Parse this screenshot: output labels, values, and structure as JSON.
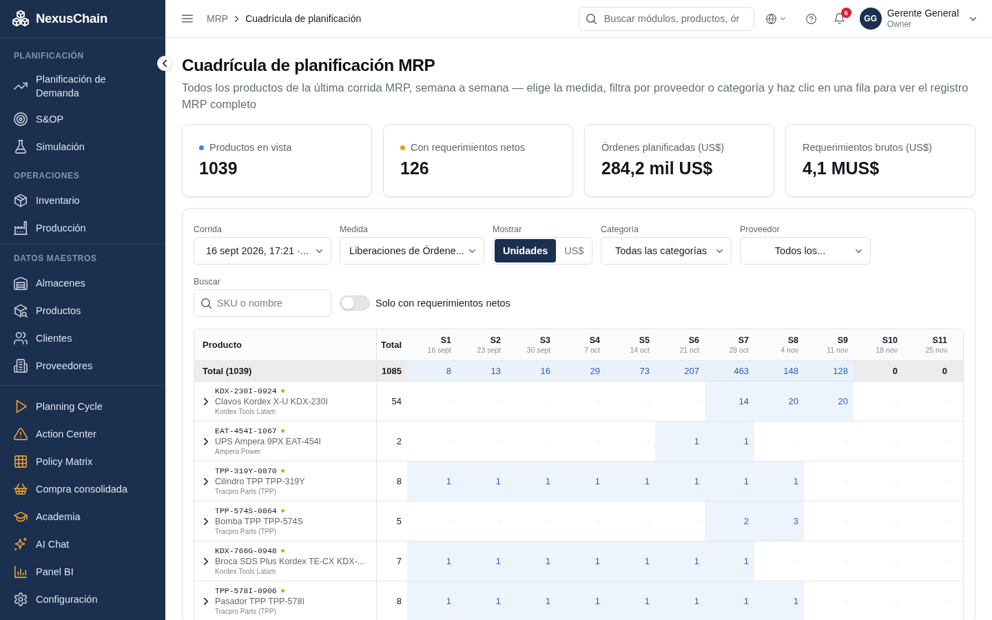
{
  "sidebar": {
    "brand": "NexusChain",
    "sections": [
      {
        "title": "PLANIFICACIÓN",
        "items": [
          {
            "label": "Planificación de Demanda",
            "selected": false
          },
          {
            "label": "S&OP",
            "selected": false
          },
          {
            "label": "Simulación",
            "selected": false
          }
        ]
      },
      {
        "title": "OPERACIONES",
        "items": [
          {
            "label": "Inventario",
            "selected": false
          },
          {
            "label": "Producción",
            "selected": false
          }
        ]
      },
      {
        "title": "DATOS MAESTROS",
        "items": [
          {
            "label": "Almacenes",
            "selected": false
          },
          {
            "label": "Productos",
            "selected": false
          },
          {
            "label": "Clientes",
            "selected": false
          },
          {
            "label": "Proveedores",
            "selected": false
          }
        ]
      },
      {
        "items": [
          {
            "label": "Planning Cycle",
            "selected": false,
            "color": "#e8a23b"
          },
          {
            "label": "Action Center",
            "selected": false,
            "color": "#e8a23b"
          },
          {
            "label": "Policy Matrix",
            "selected": false,
            "color": "#e8a23b"
          },
          {
            "label": "Compra consolidada",
            "selected": false,
            "color": "#e8a23b"
          },
          {
            "label": "Academia",
            "selected": false,
            "color": "#e8a23b"
          },
          {
            "label": "AI Chat",
            "selected": false,
            "color": "#e8a23b"
          },
          {
            "label": "Panel BI",
            "selected": false,
            "color": "#e8a23b"
          },
          {
            "label": "Configuración",
            "selected": false,
            "color": "#c3cddb"
          }
        ]
      }
    ]
  },
  "topbar": {
    "breadcrumb": [
      "MRP",
      "Cuadrícula de planificación"
    ],
    "search": {
      "placeholder": "Buscar módulos, productos, ór"
    },
    "notifications": "5",
    "user": {
      "initials": "GG",
      "name": "Gerente General",
      "role": "Owner"
    }
  },
  "page": {
    "title": "Cuadrícula de planificación MRP",
    "description": "Todos los productos de la última corrida MRP, semana a semana — elige la medida, filtra por proveedor o categoría y haz clic en una fila para ver el registro MRP completo"
  },
  "kpis": [
    {
      "label": "Productos en vista",
      "value": "1039",
      "color": "#3b82f6"
    },
    {
      "label": "Con requerimientos netos",
      "value": "126",
      "color": "#f59e0b"
    },
    {
      "label": "Órdenes planificadas (US$)",
      "value": "284,2 mil US$"
    },
    {
      "label": "Requerimientos brutos (US$)",
      "value": "4,1 MUS$"
    }
  ],
  "filters": [
    {
      "kind": "select",
      "label": "Corrida",
      "value": "16 sept 2026, 17:21 ·..."
    },
    {
      "kind": "select",
      "label": "Medida",
      "value": "Liberaciones de Órdene..."
    },
    {
      "kind": "segmented",
      "label": "Mostrar",
      "options": [
        {
          "label": "Unidades",
          "selected": true
        },
        {
          "label": "US$",
          "selected": false
        }
      ]
    },
    {
      "kind": "select",
      "label": "Categoría",
      "value": "Todas las categorías"
    },
    {
      "kind": "select",
      "label": "Proveedor",
      "value": "Todos los..."
    }
  ],
  "search": {
    "label": "Buscar",
    "placeholder": "SKU o nombre"
  },
  "net_only": {
    "label": "Solo con requerimientos netos",
    "on": false
  },
  "table": {
    "columns": [
      "Producto",
      "Total"
    ],
    "weeks": [
      {
        "label": "S1",
        "date": "16 sept"
      },
      {
        "label": "S2",
        "date": "23 sept"
      },
      {
        "label": "S3",
        "date": "30 sept"
      },
      {
        "label": "S4",
        "date": "7 oct"
      },
      {
        "label": "S5",
        "date": "14 oct"
      },
      {
        "label": "S6",
        "date": "21 oct"
      },
      {
        "label": "S7",
        "date": "28 oct"
      },
      {
        "label": "S8",
        "date": "4 nov"
      },
      {
        "label": "S9",
        "date": "11 nov"
      },
      {
        "label": "S10",
        "date": "18 nov"
      },
      {
        "label": "S11",
        "date": "25 nov"
      }
    ],
    "total_row": {
      "label": "Total (1039)",
      "total": "1085",
      "cells": [
        {
          "value": "8",
          "highlighted": true
        },
        {
          "value": "13",
          "highlighted": true
        },
        {
          "value": "16",
          "highlighted": true
        },
        {
          "value": "29",
          "highlighted": true
        },
        {
          "value": "73",
          "highlighted": true
        },
        {
          "value": "207",
          "highlighted": true
        },
        {
          "value": "463",
          "highlighted": true
        },
        {
          "value": "148",
          "highlighted": true
        },
        {
          "value": "128",
          "highlighted": true
        },
        {
          "value": "0",
          "highlighted": false
        },
        {
          "value": "0",
          "highlighted": false
        }
      ]
    },
    "rows": [
      {
        "sku": "KDX-230I-0924",
        "color": "#f59e0b",
        "name": "Clavos Kordex X-U KDX-230I",
        "supplier": "Kordex Tools Latam",
        "expanded": false,
        "total": "54",
        "cells": [
          {
            "value": "·",
            "highlighted": false
          },
          {
            "value": "·",
            "highlighted": false
          },
          {
            "value": "·",
            "highlighted": false
          },
          {
            "value": "·",
            "highlighted": false
          },
          {
            "value": "·",
            "highlighted": false
          },
          {
            "value": "·",
            "highlighted": false
          },
          {
            "value": "14",
            "highlighted": true
          },
          {
            "value": "20",
            "highlighted": true
          },
          {
            "value": "20",
            "highlighted": true
          },
          {
            "value": "·",
            "highlighted": false
          },
          {
            "value": "·",
            "highlighted": false
          }
        ]
      },
      {
        "sku": "EAT-454I-1067",
        "color": "#f59e0b",
        "name": "UPS Ampera 9PX EAT-454I",
        "supplier": "Ampera Power",
        "expanded": false,
        "total": "2",
        "cells": [
          {
            "value": "·",
            "highlighted": false
          },
          {
            "value": "·",
            "highlighted": false
          },
          {
            "value": "·",
            "highlighted": false
          },
          {
            "value": "·",
            "highlighted": false
          },
          {
            "value": "·",
            "highlighted": false
          },
          {
            "value": "1",
            "highlighted": true
          },
          {
            "value": "1",
            "highlighted": true
          },
          {
            "value": "·",
            "highlighted": false
          },
          {
            "value": "·",
            "highlighted": false
          },
          {
            "value": "·",
            "highlighted": false
          },
          {
            "value": "·",
            "highlighted": false
          }
        ]
      },
      {
        "sku": "TPP-319Y-0870",
        "color": "#f59e0b",
        "name": "Cilindro TPP TPP-319Y",
        "supplier": "Tracpro Parts (TPP)",
        "expanded": false,
        "total": "8",
        "cells": [
          {
            "value": "1",
            "highlighted": true
          },
          {
            "value": "1",
            "highlighted": true
          },
          {
            "value": "1",
            "highlighted": true
          },
          {
            "value": "1",
            "highlighted": true
          },
          {
            "value": "1",
            "highlighted": true
          },
          {
            "value": "1",
            "highlighted": true
          },
          {
            "value": "1",
            "highlighted": true
          },
          {
            "value": "1",
            "highlighted": true
          },
          {
            "value": "·",
            "highlighted": false
          },
          {
            "value": "·",
            "highlighted": false
          },
          {
            "value": "·",
            "highlighted": false
          }
        ]
      },
      {
        "sku": "TPP-574S-0864",
        "color": "#f59e0b",
        "name": "Bomba TPP TPP-574S",
        "supplier": "Tracpro Parts (TPP)",
        "expanded": false,
        "total": "5",
        "cells": [
          {
            "value": "·",
            "highlighted": false
          },
          {
            "value": "·",
            "highlighted": false
          },
          {
            "value": "·",
            "highlighted": false
          },
          {
            "value": "·",
            "highlighted": false
          },
          {
            "value": "·",
            "highlighted": false
          },
          {
            "value": "·",
            "highlighted": false
          },
          {
            "value": "2",
            "highlighted": true
          },
          {
            "value": "3",
            "highlighted": true
          },
          {
            "value": "·",
            "highlighted": false
          },
          {
            "value": "·",
            "highlighted": false
          },
          {
            "value": "·",
            "highlighted": false
          }
        ]
      },
      {
        "sku": "KDX-766G-0948",
        "color": "#f59e0b",
        "name": "Broca SDS Plus Kordex TE-CX KDX-...",
        "supplier": "Kordex Tools Latam",
        "expanded": false,
        "total": "7",
        "cells": [
          {
            "value": "1",
            "highlighted": true
          },
          {
            "value": "1",
            "highlighted": true
          },
          {
            "value": "1",
            "highlighted": true
          },
          {
            "value": "1",
            "highlighted": true
          },
          {
            "value": "1",
            "highlighted": true
          },
          {
            "value": "1",
            "highlighted": true
          },
          {
            "value": "1",
            "highlighted": true
          },
          {
            "value": "·",
            "highlighted": false
          },
          {
            "value": "·",
            "highlighted": false
          },
          {
            "value": "·",
            "highlighted": false
          },
          {
            "value": "·",
            "highlighted": false
          }
        ]
      },
      {
        "sku": "TPP-578I-0906",
        "color": "#f59e0b",
        "name": "Pasador TPP TPP-578I",
        "supplier": "Tracpro Parts (TPP)",
        "expanded": false,
        "total": "8",
        "cells": [
          {
            "value": "1",
            "highlighted": true
          },
          {
            "value": "1",
            "highlighted": true
          },
          {
            "value": "1",
            "highlighted": true
          },
          {
            "value": "1",
            "highlighted": true
          },
          {
            "value": "1",
            "highlighted": true
          },
          {
            "value": "1",
            "highlighted": true
          },
          {
            "value": "1",
            "highlighted": true
          },
          {
            "value": "1",
            "highlighted": true
          },
          {
            "value": "·",
            "highlighted": false
          },
          {
            "value": "·",
            "highlighted": false
          },
          {
            "value": "·",
            "highlighted": false
          }
        ]
      }
    ]
  }
}
